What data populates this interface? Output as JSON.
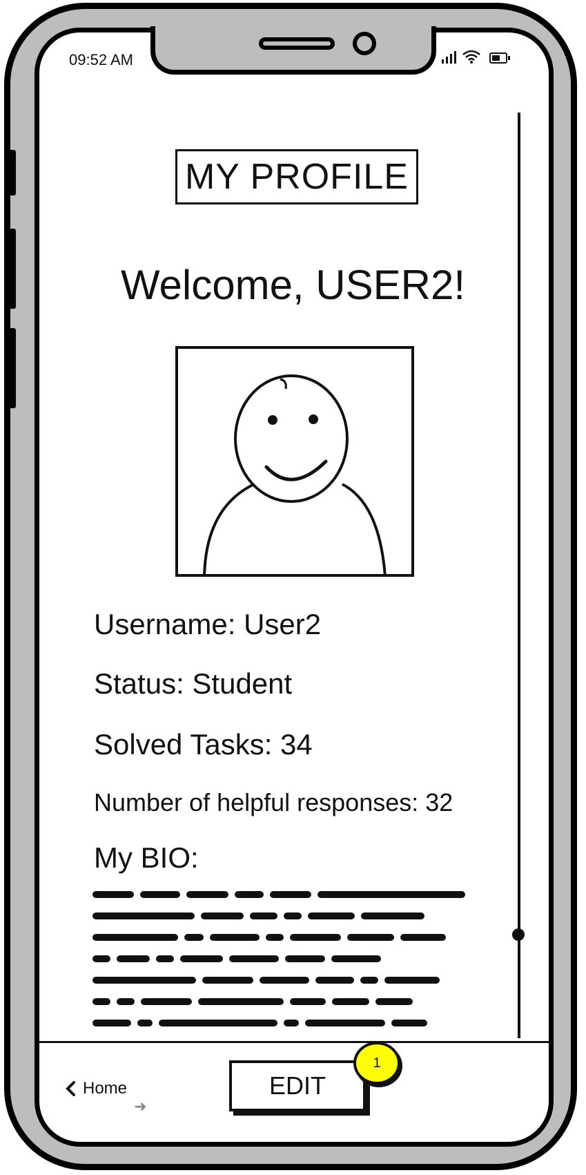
{
  "status_bar": {
    "time": "09:52 AM",
    "icons": [
      "signal-icon",
      "wifi-icon",
      "battery-icon"
    ]
  },
  "page": {
    "title": "MY PROFILE",
    "welcome": "Welcome, USER2!"
  },
  "profile": {
    "username": "Username: User2",
    "status": "Status: Student",
    "solved_tasks": "Solved Tasks: 34",
    "helpful_responses": "Number of helpful responses: 32",
    "bio_label": "My BIO:"
  },
  "bottom_bar": {
    "back_label": "Home",
    "edit_label": "EDIT",
    "badge_count": "1"
  },
  "colors": {
    "badge": "#ffff00",
    "frame": "#bdbdbd",
    "ink": "#111111"
  }
}
